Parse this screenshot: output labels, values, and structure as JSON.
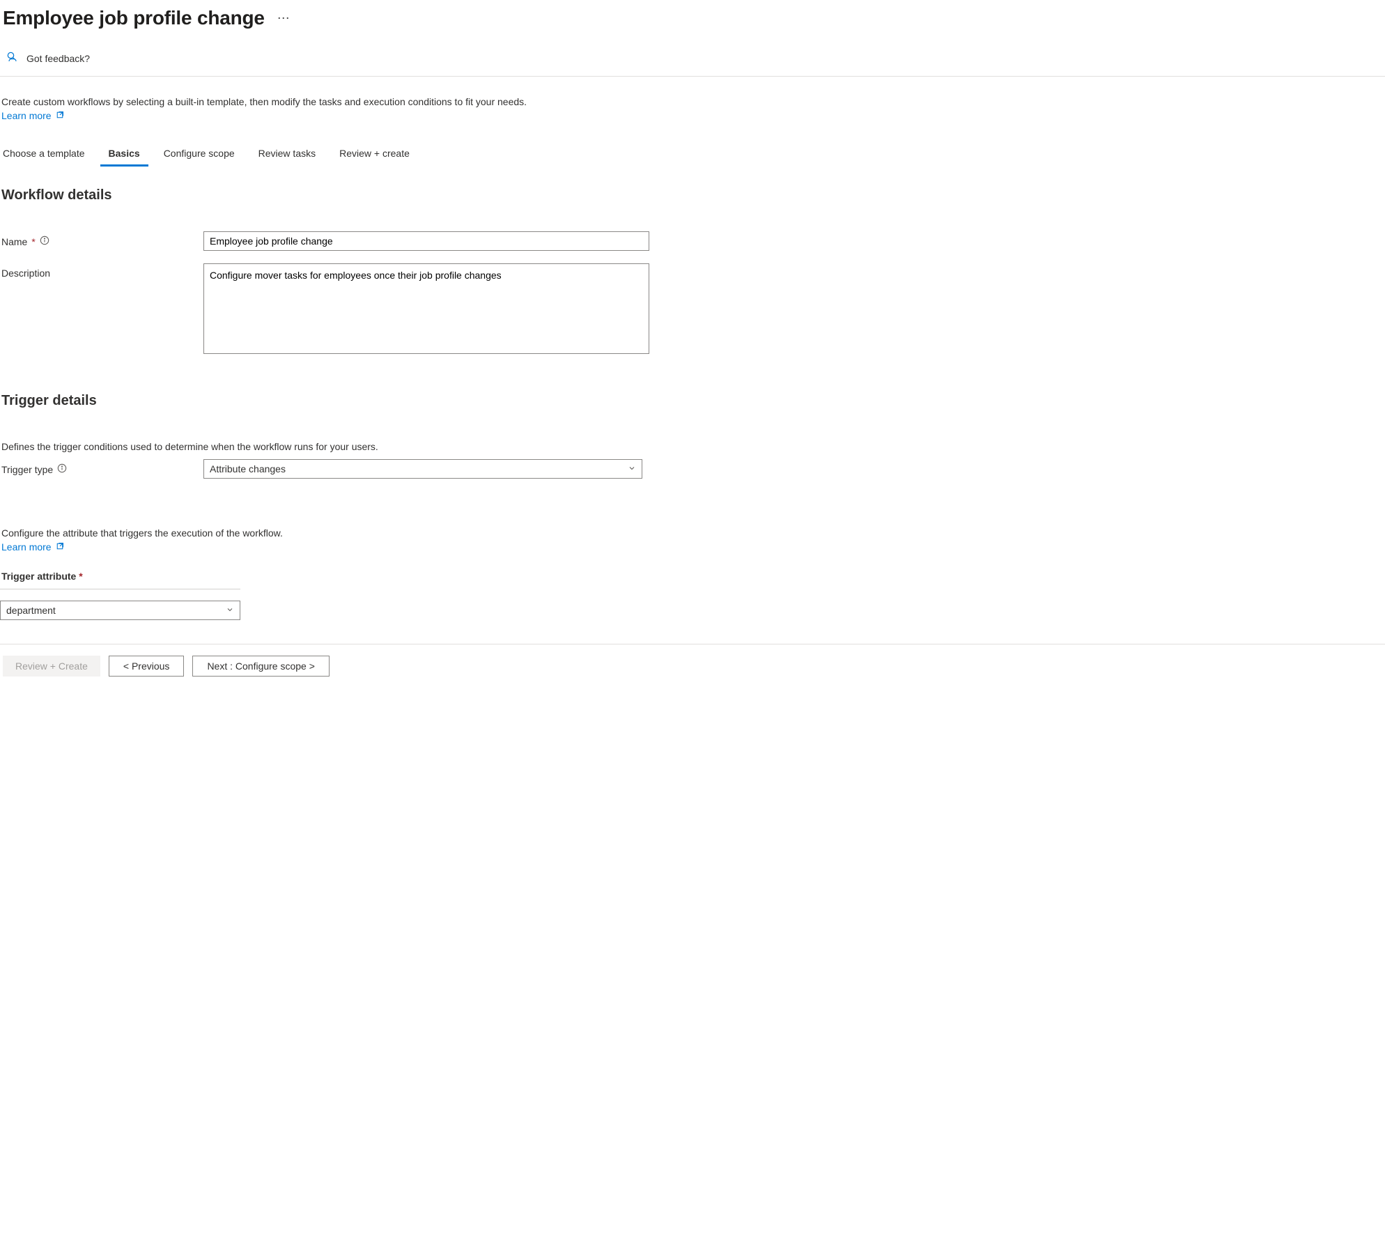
{
  "header": {
    "title": "Employee job profile change",
    "feedback_label": "Got feedback?"
  },
  "intro": {
    "text": "Create custom workflows by selecting a built-in template, then modify the tasks and execution conditions to fit your needs.",
    "learn_more": "Learn more"
  },
  "tabs": {
    "choose": "Choose a template",
    "basics": "Basics",
    "configure": "Configure scope",
    "review_tasks": "Review tasks",
    "review_create": "Review + create"
  },
  "workflow": {
    "section_title": "Workflow details",
    "name_label": "Name",
    "name_value": "Employee job profile change",
    "desc_label": "Description",
    "desc_value": "Configure mover tasks for employees once their job profile changes"
  },
  "trigger": {
    "section_title": "Trigger details",
    "desc": "Defines the trigger conditions used to determine when the workflow runs for your users.",
    "type_label": "Trigger type",
    "type_value": "Attribute changes",
    "attr_desc": "Configure the attribute that triggers the execution of the workflow.",
    "attr_learn": "Learn more",
    "attr_label": "Trigger attribute",
    "attr_value": "department"
  },
  "footer": {
    "review_create": "Review + Create",
    "previous": "< Previous",
    "next": "Next : Configure scope >"
  }
}
